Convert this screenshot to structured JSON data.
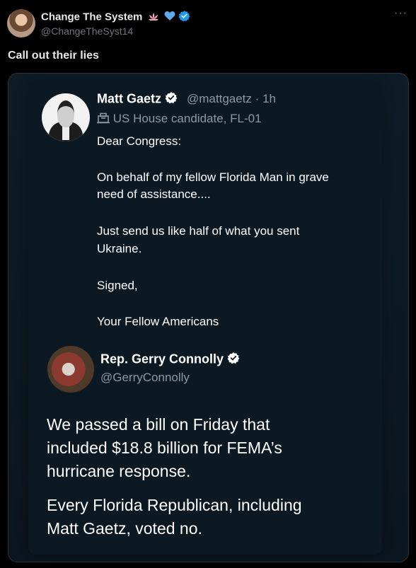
{
  "post": {
    "display_name": "Change The System",
    "name_emojis": [
      "lotus-icon",
      "blue-heart-icon"
    ],
    "handle": "@ChangeTheSyst14",
    "text": "Call out their lies",
    "more": "···"
  },
  "embedded": {
    "tweet1": {
      "name": "Matt Gaetz",
      "handle_time": "@mattgaetz · 1h",
      "subtitle": "US House candidate, FL-01",
      "lines": [
        "Dear Congress:",
        "On behalf of my fellow Florida Man in grave",
        "need of assistance....",
        "Just send us like half of what you sent",
        "Ukraine.",
        "Signed,",
        "Your Fellow Americans"
      ]
    },
    "tweet2": {
      "name": "Rep. Gerry Connolly",
      "handle": "@GerryConnolly",
      "lines": [
        "We passed a bill on Friday that",
        "included $18.8 billion for FEMA’s",
        "hurricane response.",
        "Every Florida Republican, including",
        "Matt Gaetz, voted no."
      ]
    }
  },
  "colors": {
    "background": "#000000",
    "verified_blue": "#1d9bf0",
    "muted": "#71767b"
  }
}
